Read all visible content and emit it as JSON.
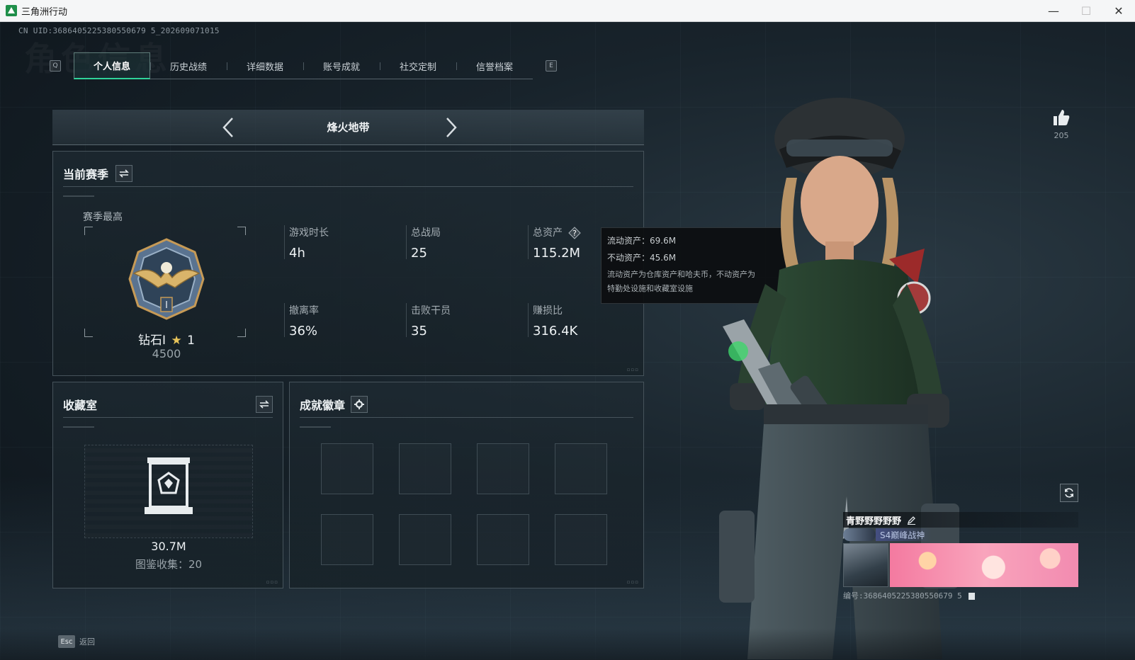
{
  "window": {
    "title": "三角洲行动",
    "minimize": "—",
    "maximize": "☐",
    "close": "✕"
  },
  "header": {
    "uid_line": "CN UID:3686405225380550679 5_202609071015",
    "watermark": "角色信息"
  },
  "tabs": {
    "prev_key": "Q",
    "next_key": "E",
    "items": [
      {
        "label": "个人信息",
        "active": true
      },
      {
        "label": "历史战绩",
        "active": false
      },
      {
        "label": "详细数据",
        "active": false
      },
      {
        "label": "账号成就",
        "active": false
      },
      {
        "label": "社交定制",
        "active": false
      },
      {
        "label": "信誉档案",
        "active": false
      }
    ]
  },
  "mode": {
    "title": "烽火地带"
  },
  "season": {
    "title": "当前赛季",
    "best_label": "赛季最高",
    "rank_name": "钻石Ⅰ",
    "rank_stars": "1",
    "rank_score": "4500",
    "stats": [
      {
        "label": "游戏时长",
        "value": "4h"
      },
      {
        "label": "总战局",
        "value": "25"
      },
      {
        "label": "总资产",
        "value": "115.2M"
      },
      {
        "label": "撤离率",
        "value": "36%"
      },
      {
        "label": "击败干员",
        "value": "35"
      },
      {
        "label": "赚损比",
        "value": "316.4K"
      }
    ]
  },
  "tooltip": {
    "liquid": "流动资产：69.6M",
    "fixed": "不动资产：45.6M",
    "desc_line1": "流动资产为仓库资产和哈夫币，不动资产为",
    "desc_line2": "特勤处设施和收藏室设施"
  },
  "collection": {
    "title": "收藏室",
    "value": "30.7M",
    "count_text": "图鉴收集：20"
  },
  "achievements": {
    "title": "成就徽章"
  },
  "profile": {
    "likes": "205",
    "nickname": "青野野野野野",
    "title_text": "S4巅峰战神",
    "uid": "编号:3686405225380550679 5"
  },
  "footer": {
    "esc_key": "Esc",
    "esc_label": "返回"
  },
  "colors": {
    "accent": "#2fd39a",
    "panel_border": "#46535b",
    "star": "#e8c45a"
  },
  "icons": {
    "swap": "swap-icon",
    "gear": "gear-icon",
    "help": "help-icon",
    "like": "thumbs-up-icon",
    "refresh": "refresh-icon",
    "edit": "pencil-icon",
    "copy": "copy-icon"
  }
}
